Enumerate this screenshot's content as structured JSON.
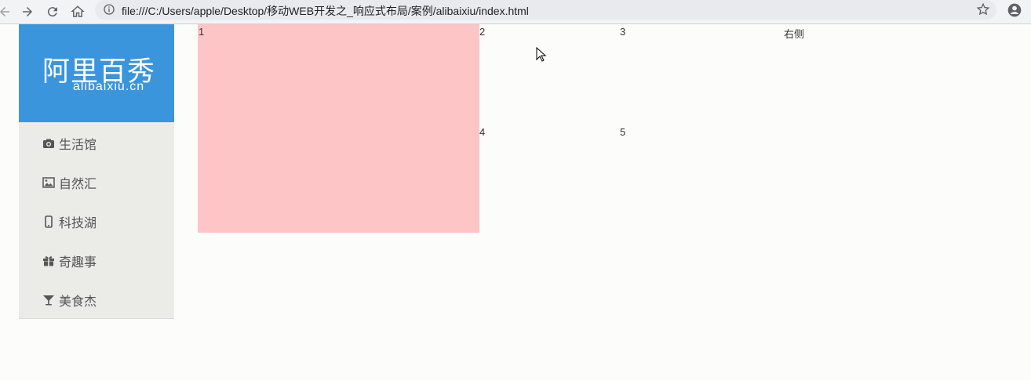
{
  "browser": {
    "url": "file:///C:/Users/apple/Desktop/移动WEB开发之_响应式布局/案例/alibaixiu/index.html"
  },
  "sidebar": {
    "logo_cn": "阿里百秀",
    "logo_en": "alibaixiu.cn",
    "items": [
      {
        "label": "生活馆",
        "icon": "camera-icon"
      },
      {
        "label": "自然汇",
        "icon": "picture-icon"
      },
      {
        "label": "科技湖",
        "icon": "phone-icon"
      },
      {
        "label": "奇趣事",
        "icon": "gift-icon"
      },
      {
        "label": "美食杰",
        "icon": "glass-icon"
      }
    ]
  },
  "content": {
    "box1": "1",
    "box2": "2",
    "box3": "3",
    "box4": "4",
    "box5": "5",
    "right": "右侧"
  },
  "colors": {
    "logo_bg": "#3a95dc",
    "sidebar_bg": "#ebebe8",
    "box1_bg": "#fec5c6"
  }
}
